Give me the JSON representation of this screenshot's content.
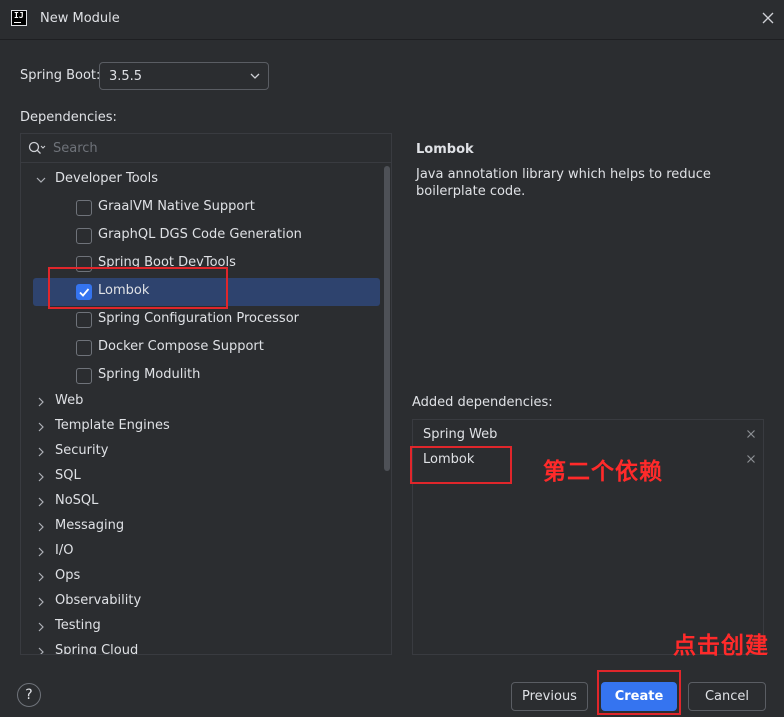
{
  "window": {
    "title": "New Module",
    "logo_text": "IJ"
  },
  "spring_boot": {
    "label": "Spring Boot:",
    "version": "3.5.5"
  },
  "dependencies": {
    "label": "Dependencies:",
    "search_placeholder": "Search",
    "tree": [
      {
        "label": "Developer Tools",
        "expanded": true
      },
      {
        "label": "GraalVM Native Support",
        "checked": false
      },
      {
        "label": "GraphQL DGS Code Generation",
        "checked": false
      },
      {
        "label": "Spring Boot DevTools",
        "checked": false
      },
      {
        "label": "Lombok",
        "checked": true,
        "selected": true
      },
      {
        "label": "Spring Configuration Processor",
        "checked": false
      },
      {
        "label": "Docker Compose Support",
        "checked": false
      },
      {
        "label": "Spring Modulith",
        "checked": false
      },
      {
        "label": "Web",
        "expanded": false
      },
      {
        "label": "Template Engines",
        "expanded": false
      },
      {
        "label": "Security",
        "expanded": false
      },
      {
        "label": "SQL",
        "expanded": false
      },
      {
        "label": "NoSQL",
        "expanded": false
      },
      {
        "label": "Messaging",
        "expanded": false
      },
      {
        "label": "I/O",
        "expanded": false
      },
      {
        "label": "Ops",
        "expanded": false
      },
      {
        "label": "Observability",
        "expanded": false
      },
      {
        "label": "Testing",
        "expanded": false
      },
      {
        "label": "Spring Cloud",
        "expanded": false
      }
    ]
  },
  "description": {
    "title": "Lombok",
    "text": "Java annotation library which helps to reduce boilerplate code."
  },
  "added": {
    "label": "Added dependencies:",
    "items": [
      "Spring Web",
      "Lombok"
    ]
  },
  "annotations": {
    "second_dependency": "第二个依赖",
    "click_create": "点击创建",
    "color": "#ff2a2a"
  },
  "buttons": {
    "help": "?",
    "previous": "Previous",
    "create": "Create",
    "cancel": "Cancel"
  },
  "colors": {
    "background": "#2b2d30",
    "accent": "#3574f0",
    "selection": "#2e436e"
  }
}
